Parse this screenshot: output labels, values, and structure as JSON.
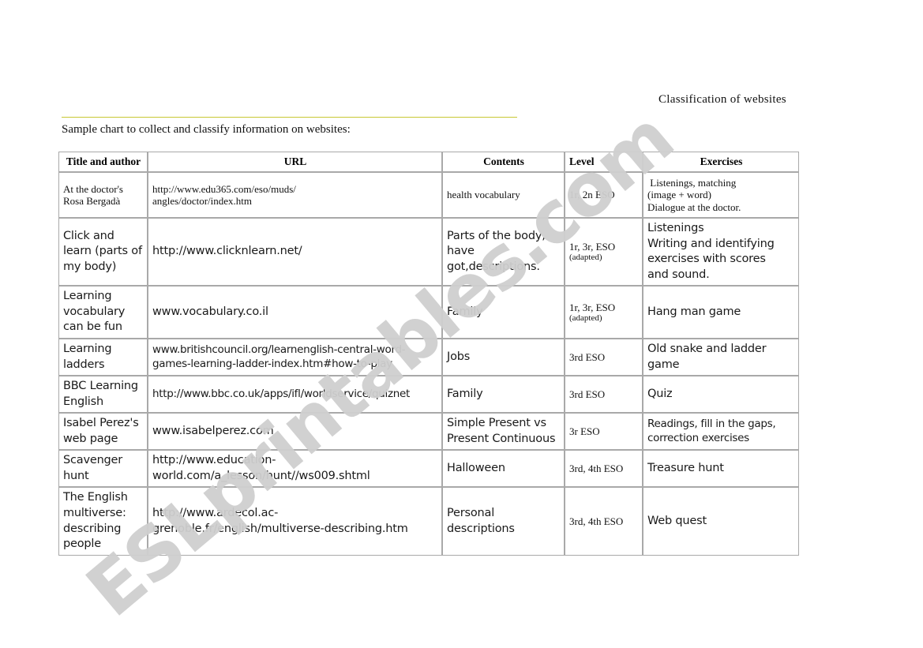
{
  "header": {
    "title": "Classification of websites"
  },
  "subtitle": "Sample chart to collect and classify information on websites:",
  "rule_color": "#c8c832",
  "watermark": {
    "text": "ESLprintables.com",
    "color": "#cfcfcf"
  },
  "table": {
    "columns": [
      {
        "key": "title",
        "label": "Title and author"
      },
      {
        "key": "url",
        "label": "URL"
      },
      {
        "key": "contents",
        "label": "Contents"
      },
      {
        "key": "level",
        "label": "Level"
      },
      {
        "key": "exercises",
        "label": "Exercises"
      }
    ],
    "rows": [
      {
        "title": "At the doctor's\nRosa Bergadà",
        "url": "http://www.edu365.com/eso/muds/\nangles/doctor/index.htm",
        "contents": "health vocabulary",
        "level": "1r, 2n ESO",
        "level_note": "",
        "exercises": " Listenings, matching\n(image + word)\nDialogue at the doctor."
      },
      {
        "title": "Click and\nlearn (parts of\nmy body)",
        "url": "http://www.clicknlearn.net/",
        "contents": "Parts of the body,\nhave\ngot,descriptions.",
        "level": "1r, 3r, ESO",
        "level_note": "(adapted)",
        "exercises": "Listenings\nWriting and identifying\nexercises with scores\nand sound."
      },
      {
        "title": "Learning\nvocabulary\ncan be fun",
        "url": "www.vocabulary.co.il",
        "contents": "Family",
        "level": "1r, 3r, ESO",
        "level_note": "(adapted)",
        "exercises": "Hang man game"
      },
      {
        "title": "Learning\nladders",
        "url": "www.britishcouncil.org/learnenglish-central-word-\ngames-learning-ladder-index.htm#how-to-play",
        "contents": "Jobs",
        "level": "3rd ESO",
        "level_note": "",
        "exercises": "Old snake and ladder\ngame"
      },
      {
        "title": "BBC Learning\nEnglish",
        "url": "http://www.bbc.co.uk/apps/ifl/worldservice/quiznet",
        "contents": "Family",
        "level": "3rd ESO",
        "level_note": "",
        "exercises": "Quiz"
      },
      {
        "title": "Isabel Perez's\nweb page",
        "url": "www.isabelperez.com",
        "contents": "Simple Present vs\nPresent Continuous",
        "level": "3r ESO",
        "level_note": "",
        "exercises": "Readings, fill in the gaps,\ncorrection exercises"
      },
      {
        "title": "Scavenger\nhunt",
        "url": "http://www.education-\nworld.com/a_lesson/hunt//ws009.shtml",
        "contents": "Halloween",
        "level": "3rd, 4th ESO",
        "level_note": "",
        "exercises": "Treasure hunt"
      },
      {
        "title": "The English\nmultiverse:\ndescribing\npeople",
        "url": "http://www.ardecol.ac-\ngrenoble.fr/english/multiverse-describing.htm",
        "contents": "Personal\ndescriptions",
        "level": "3rd, 4th ESO",
        "level_note": "",
        "exercises": " Web quest"
      }
    ]
  }
}
